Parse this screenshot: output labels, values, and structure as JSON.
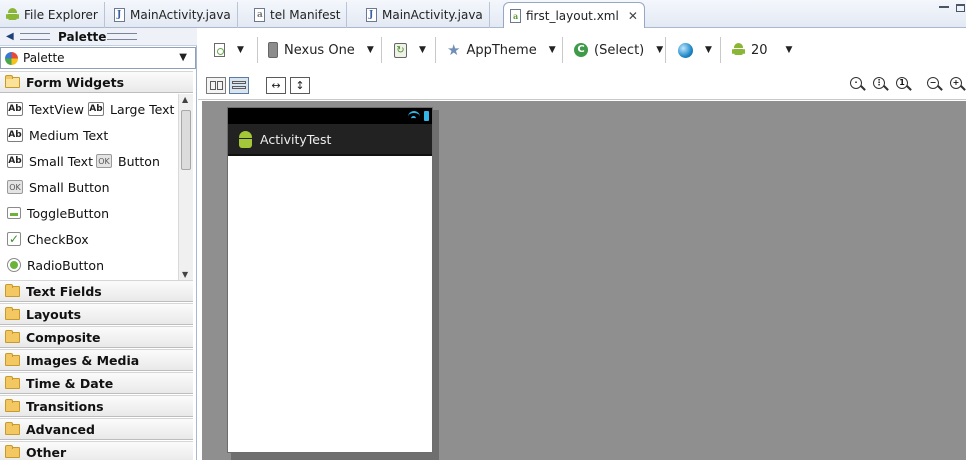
{
  "tabs": [
    {
      "label": "File Explorer",
      "icon": "android-icon"
    },
    {
      "label": "MainActivity.java",
      "icon": "java-file-icon"
    },
    {
      "label": "tel Manifest",
      "icon": "manifest-file-icon"
    },
    {
      "label": "MainActivity.java",
      "icon": "java-file-icon"
    },
    {
      "label": "first_layout.xml",
      "icon": "xml-file-icon",
      "active": true,
      "close": "✕"
    }
  ],
  "palette": {
    "title": "Palette",
    "selector": "Palette",
    "open_category": "Form Widgets",
    "widgets": [
      {
        "label": "TextView",
        "icon": "Ab"
      },
      {
        "label": "Large Text",
        "icon": "Ab"
      },
      {
        "label": "Medium Text",
        "icon": "Ab"
      },
      {
        "label": "Small Text",
        "icon": "Ab"
      },
      {
        "label": "Button",
        "icon": "OK"
      },
      {
        "label": "Small Button",
        "icon": "OK"
      },
      {
        "label": "ToggleButton",
        "icon": "toggle-icon"
      },
      {
        "label": "CheckBox",
        "icon": "checkbox-icon"
      },
      {
        "label": "RadioButton",
        "icon": "radio-icon"
      }
    ],
    "categories": [
      "Text Fields",
      "Layouts",
      "Composite",
      "Images & Media",
      "Time & Date",
      "Transitions",
      "Advanced",
      "Other"
    ]
  },
  "toolbar": {
    "device": "Nexus One",
    "theme": "AppTheme",
    "activity": "(Select)",
    "api_level": "20"
  },
  "preview": {
    "app_title": "ActivityTest",
    "statusbar_accent": "#33b5e5",
    "actionbar_color": "#222222"
  }
}
